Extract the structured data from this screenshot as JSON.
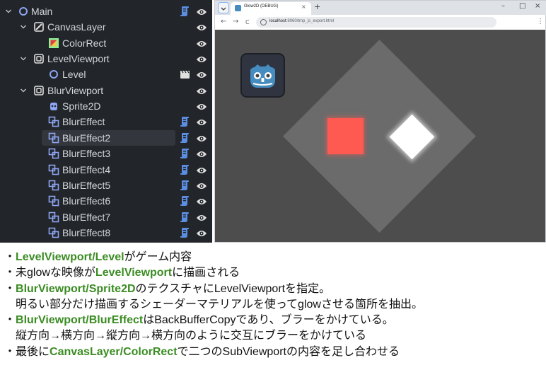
{
  "scene_tree": {
    "nodes": [
      {
        "label": "Main",
        "icon": "node-circle-icon",
        "expanded": true,
        "has_script": true,
        "has_clapper": false,
        "selected": false
      },
      {
        "label": "CanvasLayer",
        "icon": "canvas-layer-icon",
        "expanded": true,
        "has_script": false,
        "has_clapper": false,
        "selected": false
      },
      {
        "label": "ColorRect",
        "icon": "color-rect-icon",
        "expanded": false,
        "has_script": false,
        "has_clapper": false,
        "selected": false
      },
      {
        "label": "LevelViewport",
        "icon": "subviewport-icon",
        "expanded": true,
        "has_script": false,
        "has_clapper": false,
        "selected": false
      },
      {
        "label": "Level",
        "icon": "node-circle-icon",
        "expanded": false,
        "has_script": false,
        "has_clapper": true,
        "selected": false
      },
      {
        "label": "BlurViewport",
        "icon": "subviewport-icon",
        "expanded": true,
        "has_script": false,
        "has_clapper": false,
        "selected": false
      },
      {
        "label": "Sprite2D",
        "icon": "sprite2d-icon",
        "expanded": false,
        "has_script": false,
        "has_clapper": false,
        "selected": false
      },
      {
        "label": "BlurEffect",
        "icon": "backbuffer-copy-icon",
        "expanded": false,
        "has_script": true,
        "has_clapper": false,
        "selected": false
      },
      {
        "label": "BlurEffect2",
        "icon": "backbuffer-copy-icon",
        "expanded": false,
        "has_script": true,
        "has_clapper": false,
        "selected": true
      },
      {
        "label": "BlurEffect3",
        "icon": "backbuffer-copy-icon",
        "expanded": false,
        "has_script": true,
        "has_clapper": false,
        "selected": false
      },
      {
        "label": "BlurEffect4",
        "icon": "backbuffer-copy-icon",
        "expanded": false,
        "has_script": true,
        "has_clapper": false,
        "selected": false
      },
      {
        "label": "BlurEffect5",
        "icon": "backbuffer-copy-icon",
        "expanded": false,
        "has_script": true,
        "has_clapper": false,
        "selected": false
      },
      {
        "label": "BlurEffect6",
        "icon": "backbuffer-copy-icon",
        "expanded": false,
        "has_script": true,
        "has_clapper": false,
        "selected": false
      },
      {
        "label": "BlurEffect7",
        "icon": "backbuffer-copy-icon",
        "expanded": false,
        "has_script": true,
        "has_clapper": false,
        "selected": false
      },
      {
        "label": "BlurEffect8",
        "icon": "backbuffer-copy-icon",
        "expanded": false,
        "has_script": true,
        "has_clapper": false,
        "selected": false
      }
    ]
  },
  "browser": {
    "tab_title": "Glow2D (DEBUG)",
    "tab_close": "×",
    "new_tab": "+",
    "window_controls": {
      "minimize": "–",
      "maximize": "□",
      "close": "×"
    },
    "nav": {
      "back": "←",
      "forward": "→",
      "reload": "C"
    },
    "url_host": "localhost",
    "url_rest": ":8060/tmp_js_export.html",
    "menu": "⋮"
  },
  "colors": {
    "tree_bg": "#222529",
    "accent_script": "#5b8ee0",
    "highlight_text": "#3a8c22",
    "viewport_bg": "#4d4d4d",
    "diamond": "#6b6b6b",
    "red_square": "#ff5a52",
    "godot_blue": "#478cbf"
  },
  "notes": {
    "line1": {
      "bullet": "・",
      "hl1": "LevelViewport/Level",
      "t1": "がゲーム内容"
    },
    "line2": {
      "t0": "・未glowな映像が",
      "hl1": "LevelViewport",
      "t1": "に描画される"
    },
    "line3": {
      "bullet": "・",
      "hl1": "BlurViewport/Sprite2D",
      "t1": "のテクスチャにLevelViewportを指定。"
    },
    "line4": {
      "t0": "明るい部分だけ描画するシェーダーマテリアルを使ってglowさせる箇所を抽出。"
    },
    "line5": {
      "bullet": "・",
      "hl1": "BlurViewport/BlurEffect",
      "t1": "はBackBufferCopyであり、ブラーをかけている。"
    },
    "line6": {
      "t0": "縦方向→横方向→縦方向→横方向のように交互にブラーをかけている"
    },
    "line7": {
      "t0": "・最後に",
      "hl1": "CanvasLayer/ColorRect",
      "t1": "で二つのSubViewportの内容を足し合わせる"
    }
  }
}
